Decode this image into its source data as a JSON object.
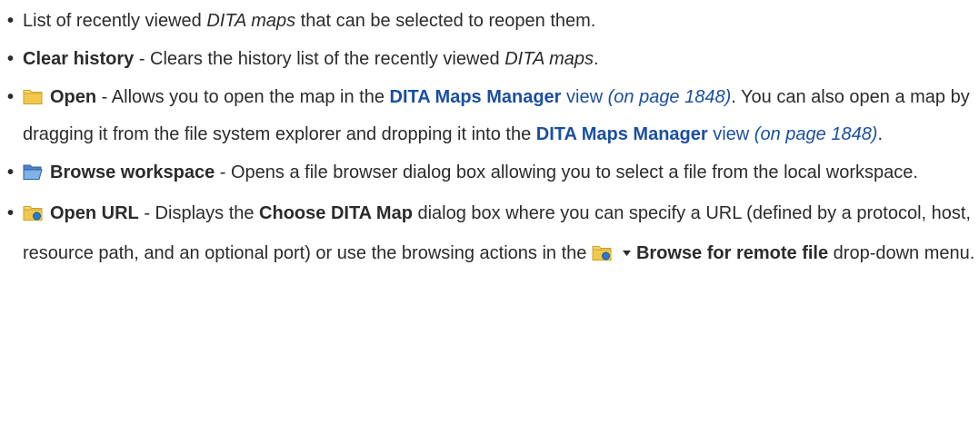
{
  "items": {
    "recent": {
      "text_a": "List of recently viewed ",
      "text_em": "DITA maps",
      "text_b": " that can be selected to reopen them."
    },
    "clear": {
      "label": "Clear history",
      "text_a": " - Clears the history list of the recently viewed ",
      "text_em": "DITA maps",
      "text_b": "."
    },
    "open": {
      "icon": "folder-icon",
      "label": "Open",
      "text_a": " - Allows you to open the map in the ",
      "link1": "DITA Maps Manager",
      "link1_view": " view",
      "ref1": " (on page 1848)",
      "text_b": ". You can also open a map by dragging it from the file system explorer and dropping it into the ",
      "link2": "DITA Maps Manager",
      "link2_view": " view",
      "ref2": " (on page 1848)",
      "text_c": "."
    },
    "browse": {
      "icon": "folder-open-icon",
      "label": "Browse workspace",
      "text_a": " - Opens a file browser dialog box allowing you to select a file from the local workspace."
    },
    "open_url": {
      "icon": "folder-url-icon",
      "label": "Open URL",
      "text_a": " - Displays the ",
      "dialog": "Choose DITA Map",
      "text_b": " dialog box where you can specify a URL (defined by a protocol, host, resource path, and an optional port) or use the browsing actions in the ",
      "icon2": "remote-folder-icon",
      "menu": "Browse for remote file",
      "text_c": " drop-down menu."
    }
  },
  "colors": {
    "text": "#2b2b2b",
    "link": "#1b4fa0",
    "folder": "#f2c94c"
  }
}
